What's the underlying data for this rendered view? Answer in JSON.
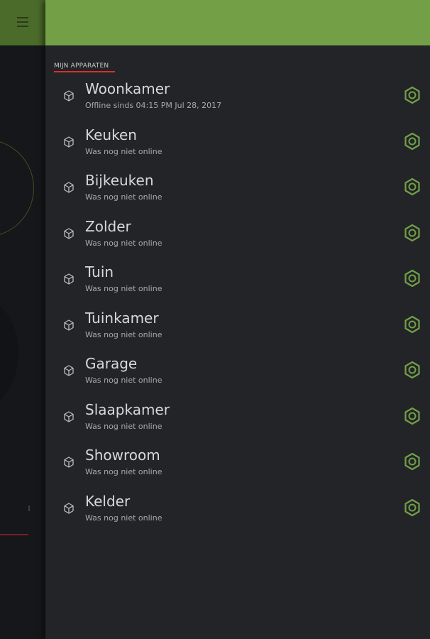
{
  "section_title": "MIJN APPARATEN",
  "devices": [
    {
      "name": "Woonkamer",
      "status": "Offline sinds 04:15 PM Jul 28, 2017"
    },
    {
      "name": "Keuken",
      "status": "Was nog niet online"
    },
    {
      "name": "Bijkeuken",
      "status": "Was nog niet online"
    },
    {
      "name": "Zolder",
      "status": "Was nog niet online"
    },
    {
      "name": "Tuin",
      "status": "Was nog niet online"
    },
    {
      "name": "Tuinkamer",
      "status": "Was nog niet online"
    },
    {
      "name": "Garage",
      "status": "Was nog niet online"
    },
    {
      "name": "Slaapkamer",
      "status": "Was nog niet online"
    },
    {
      "name": "Showroom",
      "status": "Was nog niet online"
    },
    {
      "name": "Kelder",
      "status": "Was nog niet online"
    }
  ],
  "icons": {
    "device": "cube-icon",
    "settings": "hexagon-nut-icon",
    "menu": "hamburger-menu-icon"
  },
  "colors": {
    "accent": "#73a046",
    "underline": "#d63030",
    "background": "#222428"
  }
}
